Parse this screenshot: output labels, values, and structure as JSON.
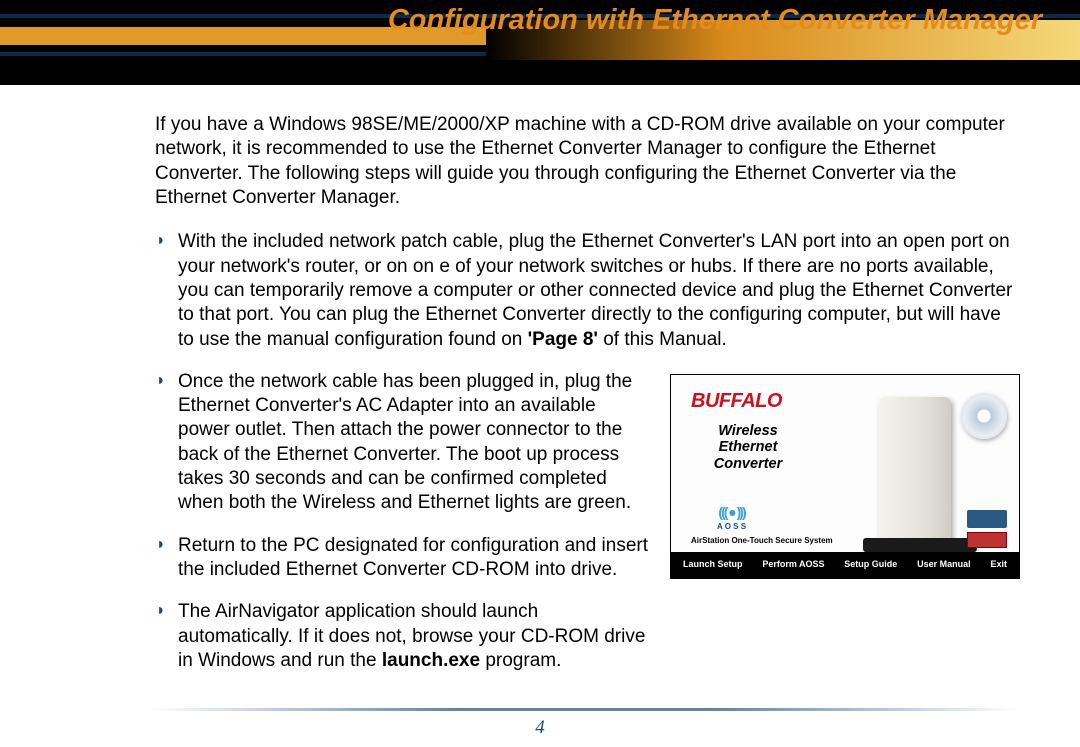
{
  "header": {
    "title": "Configuration with Ethernet Converter Manager"
  },
  "intro": "If you have a Windows 98SE/ME/2000/XP machine with a CD-ROM drive available on your computer network, it is recommended to use the Ethernet Converter Manager to configure the Ethernet Converter.  The following steps will guide you through configuring the Ethernet Converter via the Ethernet Converter Manager.",
  "bullets": [
    {
      "pre": "With the included network patch cable, plug the Ethernet Converter's LAN port into an open port on your network's router, or on on e of your network switches or hubs.  If there are no ports available, you can temporarily remove a computer or other connected device and plug the Ethernet Converter to that port.  You can plug the Ethernet Converter directly to the configuring computer, but will have to use the manual configuration found on ",
      "bold": "'Page 8'",
      "post": " of this Manual."
    },
    {
      "pre": "Once the network cable has been plugged in, plug the Ethernet Converter's AC Adapter into an available power outlet.  Then attach the power connector to the back of the Ethernet Converter.  The boot up process takes 30 seconds and can be confirmed completed when both the Wireless and Ethernet lights are green.",
      "bold": "",
      "post": ""
    },
    {
      "pre": "Return to the PC designated for configuration and insert the included Ethernet Converter CD-ROM into drive.",
      "bold": "",
      "post": ""
    },
    {
      "pre": "The AirNavigator application should launch automatically.  If it does not, browse your CD-ROM drive in Windows and run the ",
      "bold": "launch.exe",
      "post": " program."
    }
  ],
  "image": {
    "logo": "BUFFALO",
    "title_l1": "Wireless",
    "title_l2": "Ethernet",
    "title_l3": "Converter",
    "aoss": "A O S S",
    "subtitle": "AirStation One-Touch Secure System",
    "menu": [
      "Launch Setup",
      "Perform AOSS",
      "Setup Guide",
      "User Manual",
      "Exit"
    ]
  },
  "page_number": "4"
}
